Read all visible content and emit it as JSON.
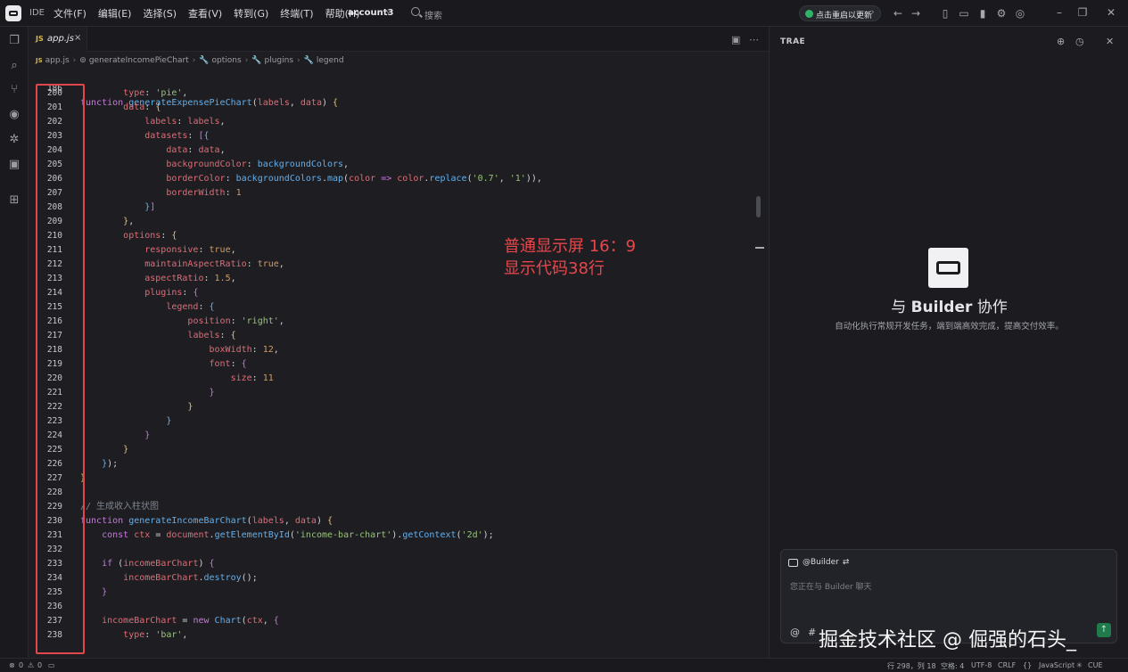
{
  "titlebar": {
    "ide_label": "IDE",
    "menu": [
      "文件(F)",
      "编辑(E)",
      "选择(S)",
      "查看(V)",
      "转到(G)",
      "终端(T)",
      "帮助(H)"
    ],
    "account": "account3",
    "search_label": "搜索",
    "update_label": "点击重启以更新"
  },
  "editor": {
    "tab": {
      "lang": "JS",
      "name": "app.js",
      "close": "×"
    },
    "breadcrumb": {
      "js": "JS",
      "file": "app.js",
      "items": [
        "generateIncomePieChart",
        "options",
        "plugins",
        "legend"
      ]
    },
    "sticky_line": {
      "num": "186",
      "text": "function generateExpensePieChart(labels, data) {"
    },
    "lines": [
      {
        "num": "200"
      },
      {
        "num": "201"
      },
      {
        "num": "202"
      },
      {
        "num": "203"
      },
      {
        "num": "204"
      },
      {
        "num": "205"
      },
      {
        "num": "206"
      },
      {
        "num": "207"
      },
      {
        "num": "208"
      },
      {
        "num": "209"
      },
      {
        "num": "210"
      },
      {
        "num": "211"
      },
      {
        "num": "212"
      },
      {
        "num": "213"
      },
      {
        "num": "214"
      },
      {
        "num": "215"
      },
      {
        "num": "216"
      },
      {
        "num": "217"
      },
      {
        "num": "218"
      },
      {
        "num": "219"
      },
      {
        "num": "220"
      },
      {
        "num": "221"
      },
      {
        "num": "222"
      },
      {
        "num": "223"
      },
      {
        "num": "224"
      },
      {
        "num": "225"
      },
      {
        "num": "226"
      },
      {
        "num": "227"
      },
      {
        "num": "228"
      },
      {
        "num": "229"
      },
      {
        "num": "230"
      },
      {
        "num": "231"
      },
      {
        "num": "232"
      },
      {
        "num": "233"
      },
      {
        "num": "234"
      },
      {
        "num": "235"
      },
      {
        "num": "236"
      },
      {
        "num": "237"
      },
      {
        "num": "238"
      }
    ],
    "annotation_line1": "普通显示屏 16：9",
    "annotation_line2": "显示代码38行"
  },
  "panel": {
    "title": "TRAE",
    "heading_prefix": "与",
    "heading_name": "Builder",
    "heading_suffix": "协作",
    "subtitle": "自动化执行常规开发任务，端到端高效完成，提高交付效率。",
    "chat_tag": "@Builder",
    "chat_placeholder": "您正在与 Builder 聊天",
    "watermark": "掘金技术社区 @ 倔强的石头_"
  },
  "statusbar": {
    "problems": "0",
    "warnings": "0",
    "position": "行 298，列 18",
    "spaces": "空格: 4",
    "encoding": "UTF-8",
    "eol": "CRLF",
    "braces": "{}",
    "language": "JavaScript",
    "extra": "CUE"
  }
}
